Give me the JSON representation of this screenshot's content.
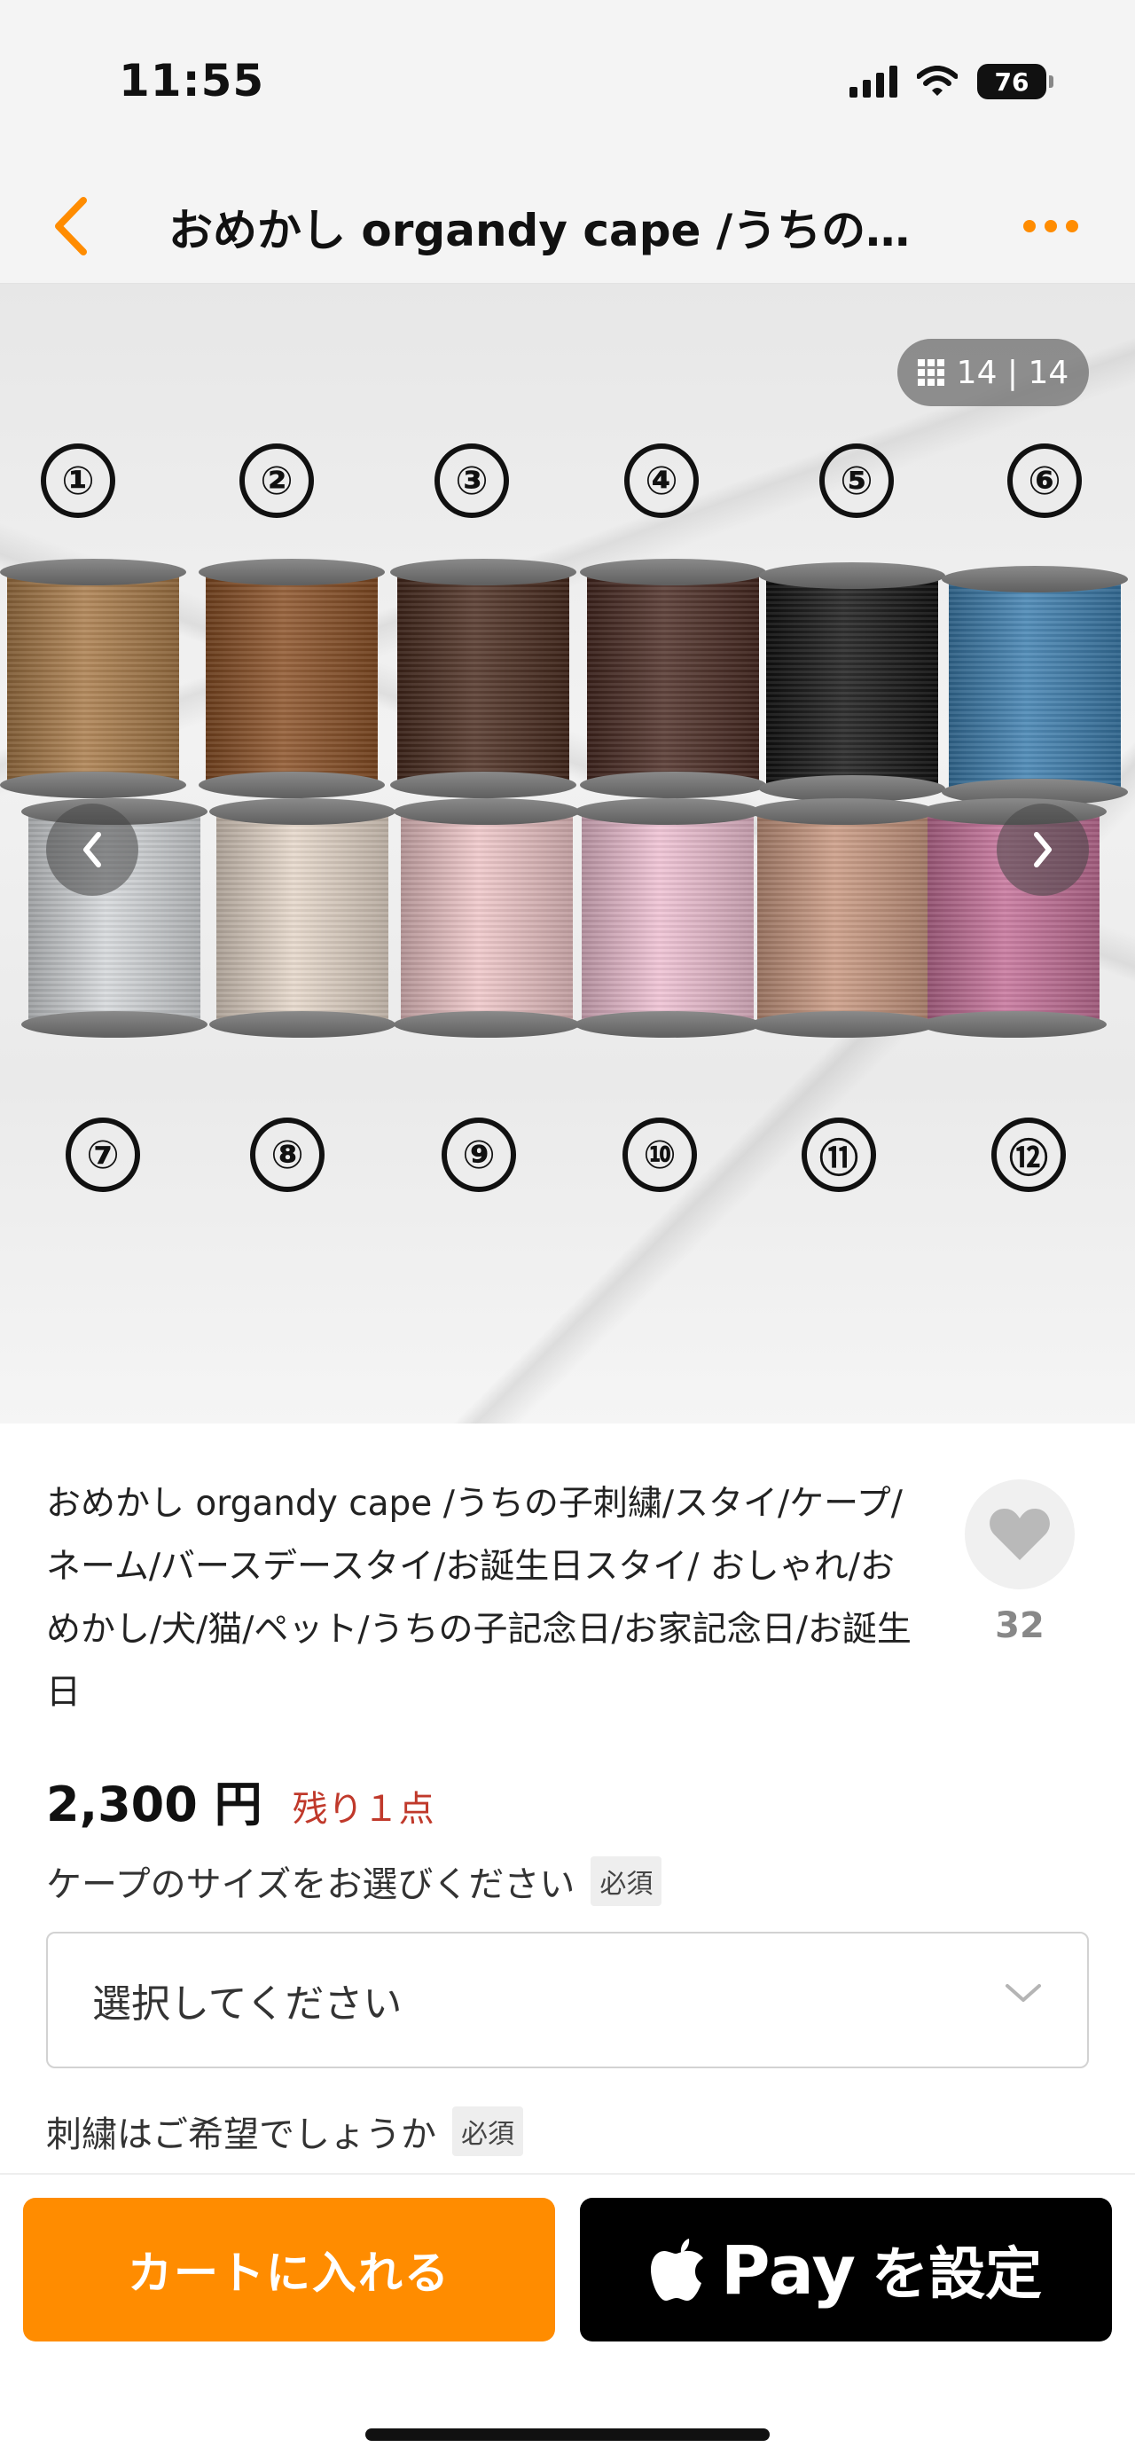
{
  "status_bar": {
    "time": "11:55",
    "battery": "76",
    "icons": [
      "signal-icon",
      "wifi-icon",
      "battery-icon"
    ]
  },
  "header": {
    "title": "おめかし organdy cape /うちの子…",
    "back_icon": "chevron-left-icon",
    "more_icon": "more-dots-icon",
    "accent": "#ff8c00"
  },
  "gallery": {
    "counter": "14 | 14",
    "counter_icon": "grid-icon",
    "top_numbers": [
      "①",
      "②",
      "③",
      "④",
      "⑤",
      "⑥"
    ],
    "bottom_numbers": [
      "⑦",
      "⑧",
      "⑨",
      "⑩",
      "⑪",
      "⑫"
    ],
    "top_colors": [
      "#a97a47",
      "#8a4f24",
      "#4a2b1e",
      "#4a2a22",
      "#141414",
      "#3c7eaf"
    ],
    "bottom_colors": [
      "#d4d7da",
      "#e5d6c8",
      "#efc5c7",
      "#efbfd2",
      "#c9977f",
      "#c56f98"
    ]
  },
  "product": {
    "title": "おめかし organdy cape /うちの子刺繍/スタイ/ケープ/ネーム/バースデースタイ/お誕生日スタイ/ おしゃれ/おめかし/犬/猫/ペット/うちの子記念日/お家記念日/お誕生日",
    "favorite_count": "32",
    "price": "2,300 円",
    "stock": "残り１点",
    "stock_color": "#c0392b"
  },
  "options": {
    "size_label": "ケープのサイズをお選びください",
    "required": "必須",
    "select_placeholder": "選択してください",
    "embroidery_label": "刺繍はご希望でしょうか"
  },
  "actions": {
    "cart_label": "カートに入れる",
    "pay_word": "Pay",
    "pay_suffix": "を設定"
  }
}
